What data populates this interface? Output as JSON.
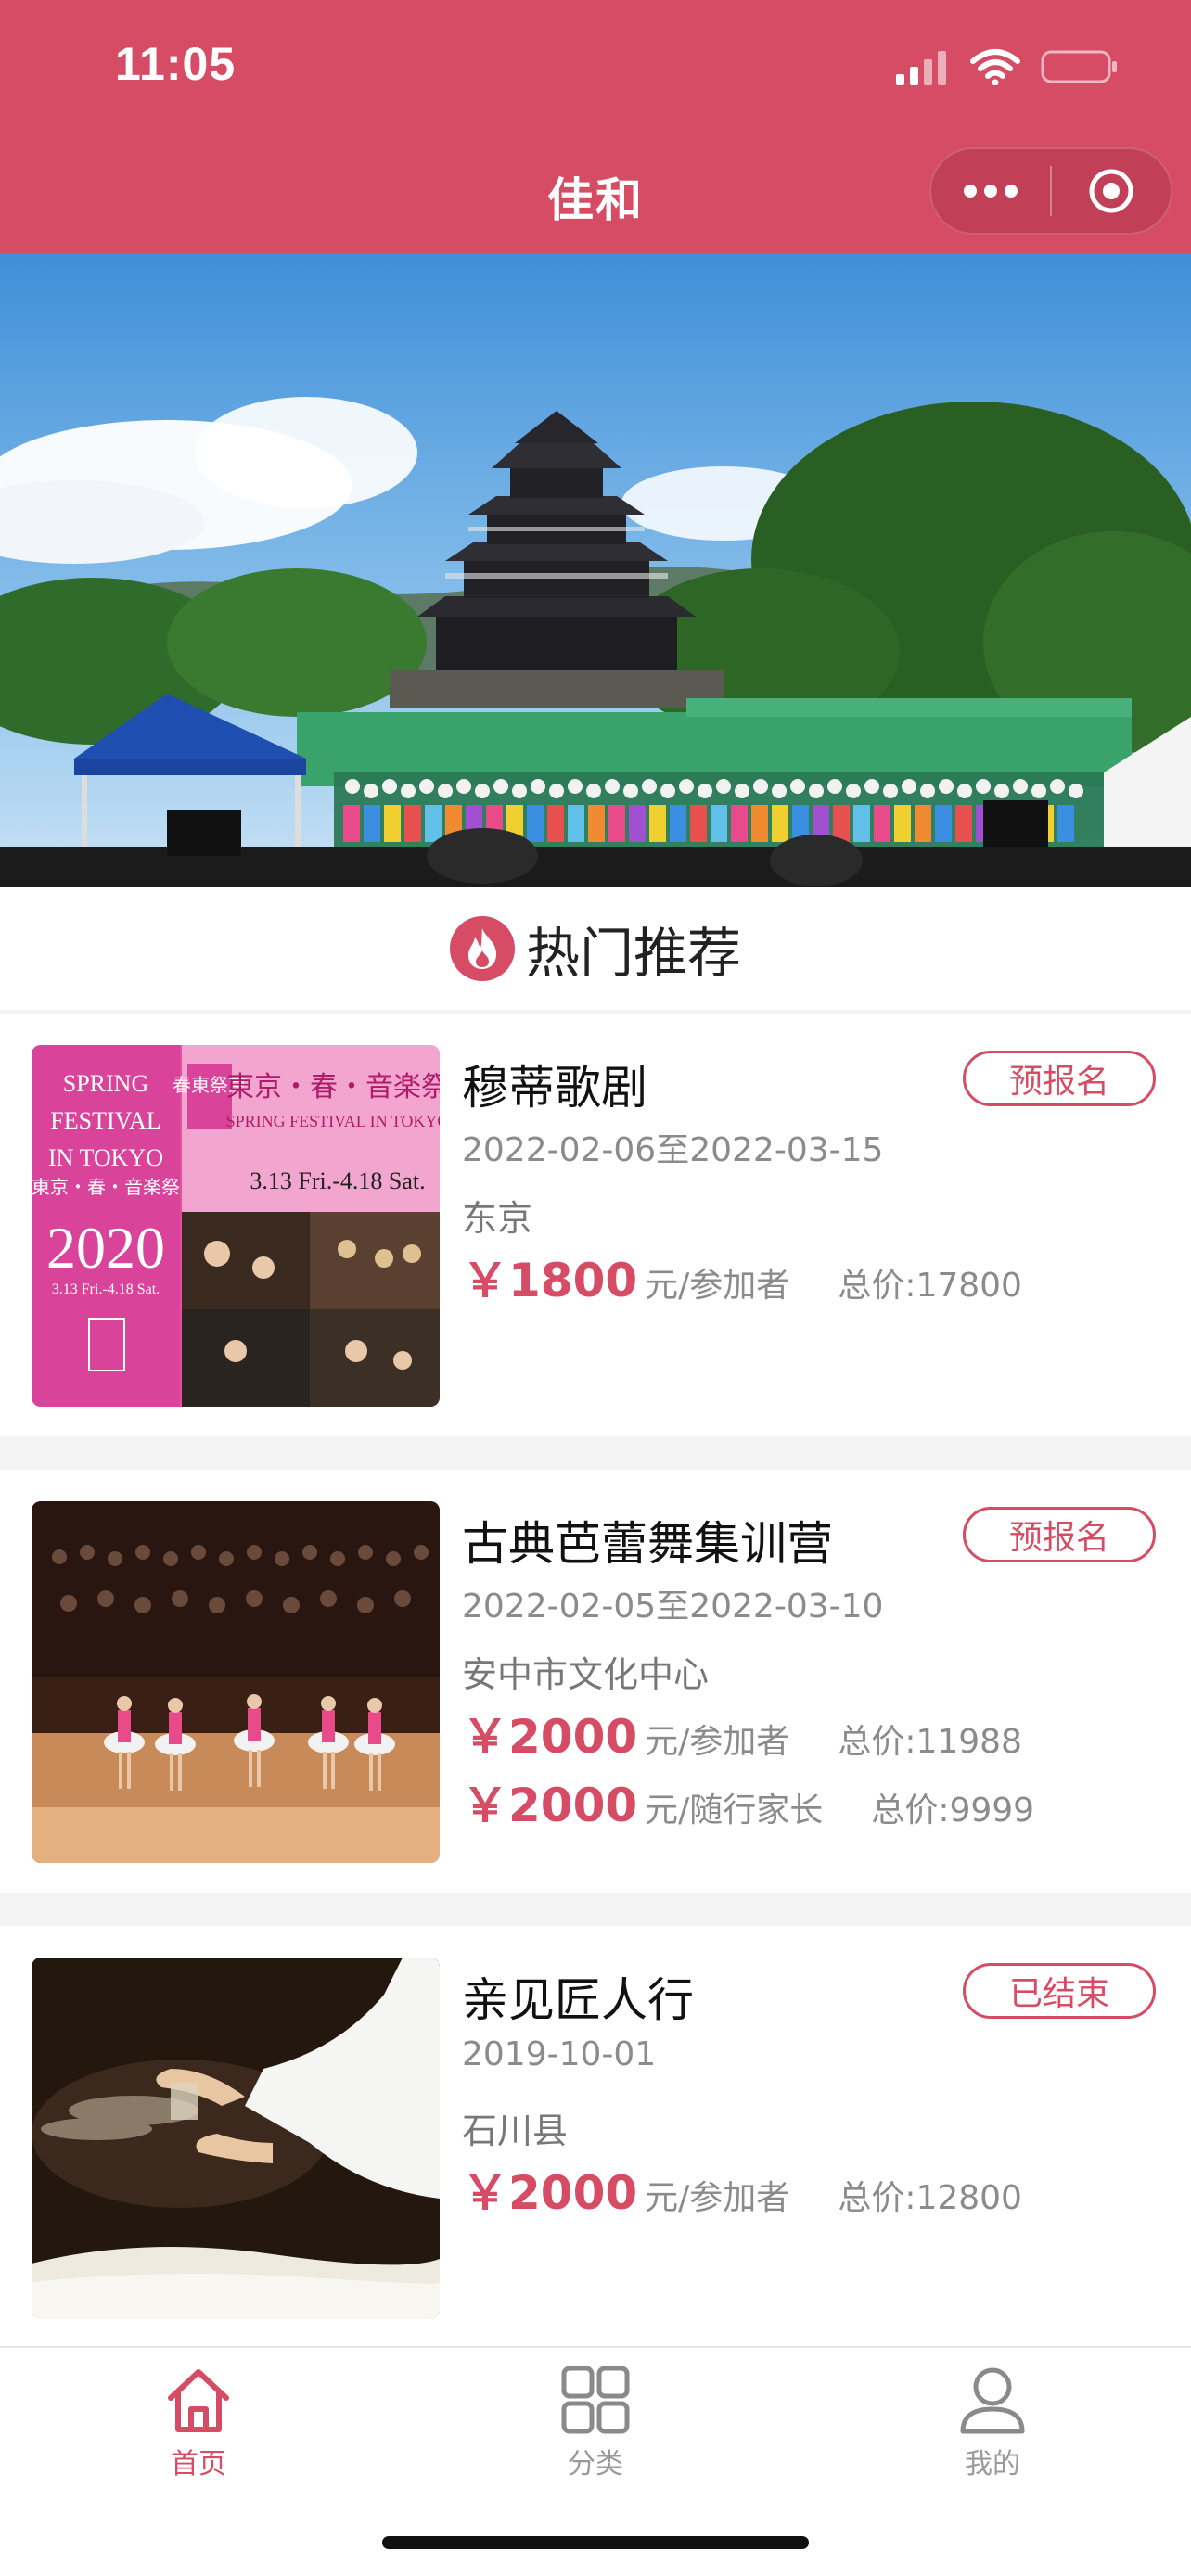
{
  "status_bar": {
    "time": "11:05"
  },
  "nav": {
    "title": "佳和",
    "more_icon": "more-dots-icon",
    "target_icon": "record-circle-icon"
  },
  "section": {
    "title": "热门推荐",
    "icon": "fire-icon"
  },
  "accent_color": "#d64c64",
  "cards": [
    {
      "name": "穆蒂歌剧",
      "badge": "预报名",
      "dates": "2022-02-06至2022-03-15",
      "place": "东京",
      "prices": [
        {
          "amount": "￥1800",
          "unit": "元/参加者",
          "total": "总价:17800"
        }
      ],
      "poster": {
        "left_lines": [
          "SPRING",
          "FESTIVAL",
          "IN TOKYO",
          "東京・春・音楽祭"
        ],
        "year": "2020",
        "left_date": "3.13 Fri.-4.18 Sat.",
        "stamp": "春東祭京",
        "right_title": "東京・春・音楽祭",
        "right_subtitle": "SPRING FESTIVAL IN TOKYO",
        "right_date": "3.13 Fri.-4.18 Sat."
      }
    },
    {
      "name": "古典芭蕾舞集训营",
      "badge": "预报名",
      "dates": "2022-02-05至2022-03-10",
      "place": "安中市文化中心",
      "prices": [
        {
          "amount": "￥2000",
          "unit": "元/参加者",
          "total": "总价:11988"
        },
        {
          "amount": "￥2000",
          "unit": "元/随行家长",
          "total": "总价:9999"
        }
      ]
    },
    {
      "name": "亲见匠人行",
      "badge": "已结束",
      "dates": "2019-10-01",
      "place": "石川县",
      "prices": [
        {
          "amount": "￥2000",
          "unit": "元/参加者",
          "total": "总价:12800"
        }
      ]
    }
  ],
  "tabbar": {
    "items": [
      {
        "label": "首页",
        "icon": "home-icon",
        "active": true
      },
      {
        "label": "分类",
        "icon": "category-grid-icon",
        "active": false
      },
      {
        "label": "我的",
        "icon": "user-icon",
        "active": false
      }
    ]
  }
}
